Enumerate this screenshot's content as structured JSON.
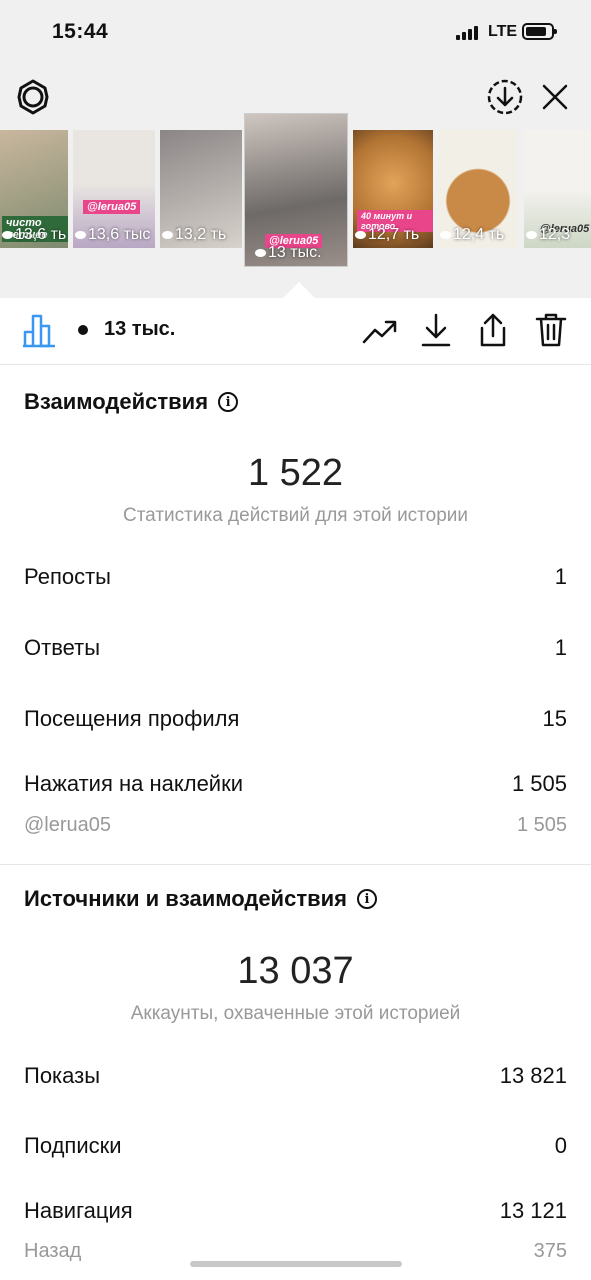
{
  "status_bar": {
    "time": "15:44",
    "network": "LTE"
  },
  "stories": [
    {
      "views": "13,6 ть",
      "colors": [
        "#c9b79e",
        "#7e8a6e"
      ],
      "overlay": "чисто летнее"
    },
    {
      "views": "13,6 тыс",
      "colors": [
        "#e9e6e2",
        "#b9a7c4"
      ],
      "overlay": "@lerua05"
    },
    {
      "views": "13,2 ть",
      "colors": [
        "#8b8686",
        "#d8d2cc"
      ],
      "overlay": ""
    },
    {
      "views": "13 тыс.",
      "colors": [
        "#6e6a68",
        "#cfc6c0"
      ],
      "overlay": "@lerua05",
      "selected": true
    },
    {
      "views": "12,7 ть",
      "colors": [
        "#b27433",
        "#e2a45a"
      ],
      "overlay": "40 минут и готово"
    },
    {
      "views": "12,4 ть",
      "colors": [
        "#c98a47",
        "#f2efe6"
      ],
      "overlay": ""
    },
    {
      "views": "12,3",
      "colors": [
        "#f4f2ef",
        "#cdd7c5"
      ],
      "overlay": "@lerua05"
    }
  ],
  "toolbar": {
    "views": "13 тыс."
  },
  "interactions": {
    "title": "Взаимодействия",
    "total": "1 522",
    "subtitle": "Статистика действий для этой истории",
    "rows": [
      {
        "label": "Репосты",
        "value": "1"
      },
      {
        "label": "Ответы",
        "value": "1"
      },
      {
        "label": "Посещения профиля",
        "value": "15"
      },
      {
        "label": "Нажатия на наклейки",
        "value": "1 505"
      }
    ],
    "sticker": {
      "label": "@lerua05",
      "value": "1 505"
    }
  },
  "discovery": {
    "title": "Источники и взаимодействия",
    "total": "13 037",
    "subtitle": "Аккаунты, охваченные этой историей",
    "rows": [
      {
        "label": "Показы",
        "value": "13 821"
      },
      {
        "label": "Подписки",
        "value": "0"
      },
      {
        "label": "Навигация",
        "value": "13 121"
      }
    ],
    "back": {
      "label": "Назад",
      "value": "375"
    }
  },
  "accent_color": "#3897f0"
}
